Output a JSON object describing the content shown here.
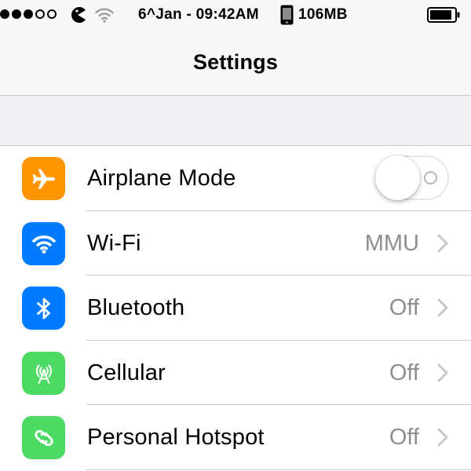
{
  "status_bar": {
    "signal_filled": 3,
    "signal_total": 5,
    "datetime": "6^Jan - 09:42AM",
    "memory": "106MB",
    "icons": [
      "signal-dots",
      "pacman-icon",
      "wifi-icon",
      "phone-icon",
      "battery-icon"
    ]
  },
  "nav": {
    "title": "Settings"
  },
  "settings": {
    "airplane": {
      "label": "Airplane Mode",
      "icon": "airplane-icon",
      "icon_color": "#ff9500",
      "toggle_on": false
    },
    "wifi": {
      "label": "Wi-Fi",
      "value": "MMU",
      "icon": "wifi-icon",
      "icon_color": "#007aff"
    },
    "bluetooth": {
      "label": "Bluetooth",
      "value": "Off",
      "icon": "bluetooth-icon",
      "icon_color": "#007aff"
    },
    "cellular": {
      "label": "Cellular",
      "value": "Off",
      "icon": "cellular-antenna-icon",
      "icon_color": "#4cd964"
    },
    "hotspot": {
      "label": "Personal Hotspot",
      "value": "Off",
      "icon": "hotspot-link-icon",
      "icon_color": "#4cd964"
    }
  }
}
